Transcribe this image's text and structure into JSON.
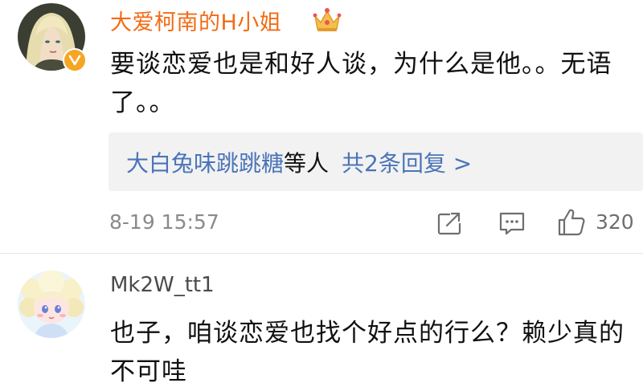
{
  "comments": [
    {
      "username": "大爱柯南的H小姐",
      "text": "要谈恋爱也是和好人谈，为什么是他。。无语了。。",
      "replies": {
        "names": "大白兔味跳跳糖",
        "suffix": "等人",
        "count_label": "共2条回复 >"
      },
      "timestamp": "8-19 15:57",
      "like_count": "320",
      "icons": {
        "badge": "verified-v-badge",
        "crown": "crown-badge-icon"
      }
    },
    {
      "username": "Mk2W_tt1",
      "text": "也子，咱谈恋爱也找个好点的行么？赖少真的不可哇"
    }
  ],
  "colors": {
    "username_highlight": "#f26b15",
    "link": "#4a74b8",
    "meta": "#8a8a8a",
    "badge": "#f5a623"
  }
}
